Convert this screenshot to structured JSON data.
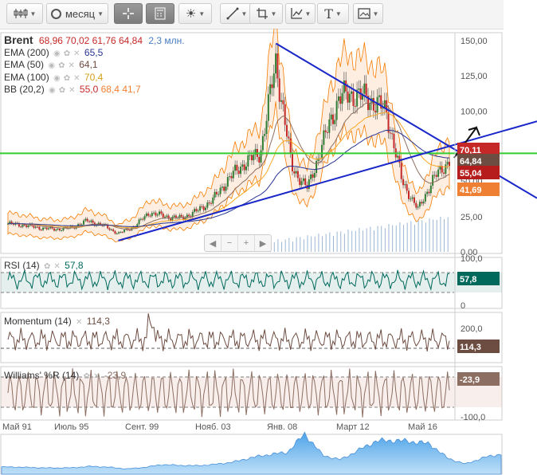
{
  "toolbar": {
    "period_label": "месяц",
    "icons": [
      "candles-icon",
      "clock-icon",
      "crosshair-icon",
      "calculator-icon",
      "indicators-icon",
      "line-tool-icon",
      "shape-tool-icon",
      "chart-type-icon",
      "text-tool-icon",
      "image-icon"
    ]
  },
  "legend": {
    "main": {
      "symbol": "Brent",
      "values": "68,96  70,02  61,76  64,84",
      "volume": "2,3 млн."
    },
    "ema200": {
      "label": "EMA (200)",
      "value": "65,5"
    },
    "ema50": {
      "label": "EMA (50)",
      "value": "64,1"
    },
    "ema100": {
      "label": "EMA (100)",
      "value": "70,4"
    },
    "bb": {
      "label": "BB (20,2)",
      "v1": "55,0",
      "v2": "68,4",
      "v3": "41,7"
    },
    "rsi": {
      "label": "RSI (14)",
      "value": "57,8"
    },
    "momentum": {
      "label": "Momentum (14)",
      "value": "114,3"
    },
    "williams": {
      "label": "Williams' %R (14)",
      "value": "-23,9"
    }
  },
  "colors": {
    "price": "#2e7d32",
    "ema200": "#283593",
    "ema50": "#8d6e63",
    "ema100": "#f9a825",
    "bb": "#f57c00",
    "trend": "#1a27c9",
    "horizontal": "#33cc33",
    "rsi": "#00695c",
    "momentum": "#6d4c41",
    "williams": "#8d6e63"
  },
  "badges": [
    {
      "text": "70,11",
      "color": "#c62828"
    },
    {
      "text": "64,84",
      "color": "#6d4c41"
    },
    {
      "text": "55,04",
      "color": "#b71c1c"
    },
    {
      "text": "41,69",
      "color": "#ef7f32"
    },
    {
      "text": "57,8",
      "color": "#00695c"
    },
    {
      "text": "114,3",
      "color": "#6d4c41"
    },
    {
      "text": "-23,9",
      "color": "#8d6e63"
    }
  ],
  "chart_data": {
    "type": "candlestick",
    "main": {
      "ylim": [
        0,
        150
      ],
      "yticks": [
        "150,00",
        "125,00",
        "100,00",
        "75,00",
        "50,00",
        "25,00",
        "0,00"
      ],
      "x": [
        "1991",
        "1992",
        "1993",
        "1994",
        "1995",
        "1996",
        "1997",
        "1998",
        "1999",
        "2000",
        "2001",
        "2002",
        "2003",
        "2004",
        "2005",
        "2006",
        "2007",
        "2008",
        "2008.5",
        "2009",
        "2010",
        "2011",
        "2012",
        "2013",
        "2014",
        "2015",
        "2016",
        "2017",
        "2018"
      ],
      "close": [
        20,
        19,
        17,
        16,
        17,
        22,
        19,
        13,
        18,
        28,
        25,
        24,
        29,
        37,
        52,
        63,
        70,
        135,
        60,
        45,
        78,
        110,
        112,
        108,
        100,
        50,
        30,
        52,
        65
      ],
      "trendlines": [
        {
          "from": [
            "1998",
            8
          ],
          "to": [
            "2018",
            75
          ]
        },
        {
          "from": [
            "2008",
            148
          ],
          "to": [
            "2018",
            75
          ]
        }
      ],
      "level": 70
    },
    "rsi": {
      "ylim": [
        0,
        100
      ],
      "yticks": [
        "100,0",
        "50",
        "0"
      ],
      "last": 57.8
    },
    "momentum": {
      "yticks": [
        "200,0",
        "100"
      ],
      "last": 114.3
    },
    "williams": {
      "ylim": [
        -100,
        0
      ],
      "yticks": [
        "0",
        "-100,0"
      ],
      "last": -23.9
    },
    "x_labels": [
      "Май 91",
      "Июль 95",
      "Сент. 99",
      "Нояб. 03",
      "Янв. 08",
      "Март 12",
      "Май 16"
    ]
  }
}
